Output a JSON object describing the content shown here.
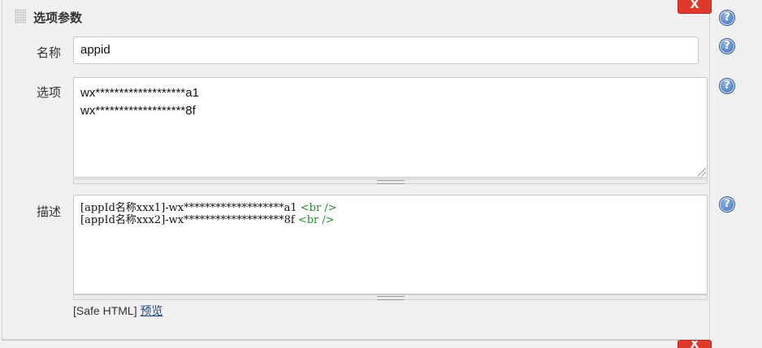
{
  "section": {
    "title": "选项参数",
    "delete_label": "X"
  },
  "fields": {
    "name": {
      "label": "名称",
      "value": "appid"
    },
    "options": {
      "label": "选项",
      "lines": [
        "wx*******************a1",
        "wx*******************8f"
      ]
    },
    "description": {
      "label": "描述",
      "lines": [
        {
          "text": "[appId名称xxx1]-wx*******************a1 ",
          "tag": "<br />"
        },
        {
          "text": "[appId名称xxx2]-wx*******************8f ",
          "tag": "<br />"
        }
      ]
    }
  },
  "footer": {
    "safe_html": "[Safe HTML]",
    "preview_link": "预览"
  },
  "help_icon_glyph": "?",
  "colors": {
    "delete_button": "#e0392b",
    "help_icon": "#3b6db5",
    "html_tag": "#2a8a2a",
    "link": "#204a87"
  }
}
